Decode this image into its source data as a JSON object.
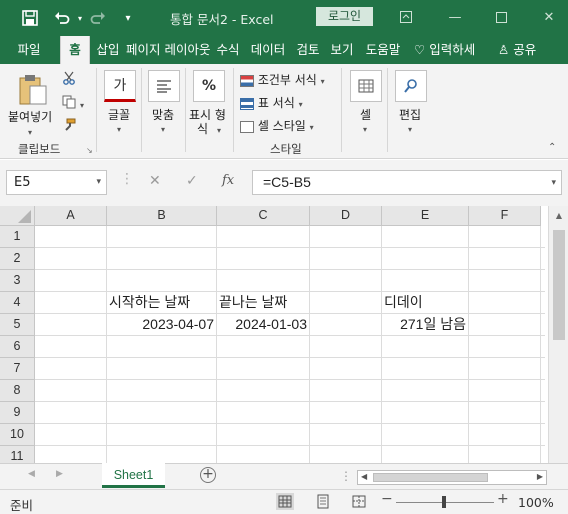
{
  "window": {
    "title": "통합 문서2  -  Excel",
    "login_label": "로그인"
  },
  "ribbon_tabs": [
    {
      "label": "파일",
      "active": false
    },
    {
      "label": "홈",
      "active": true
    },
    {
      "label": "삽입",
      "active": false
    },
    {
      "label": "페이지 레이아웃",
      "active": false
    },
    {
      "label": "수식",
      "active": false
    },
    {
      "label": "데이터",
      "active": false
    },
    {
      "label": "검토",
      "active": false
    },
    {
      "label": "보기",
      "active": false
    },
    {
      "label": "도움말",
      "active": false
    }
  ],
  "ribbon_extra": {
    "tell_me": "입력하세",
    "share": "공유"
  },
  "ribbon": {
    "paste": "붙여넣기",
    "clipboard_group": "클립보드",
    "font": "글꼴",
    "font_icon": "가",
    "alignment": "맞춤",
    "number_line1": "표시 형",
    "number_line2": "식",
    "number_icon": "%",
    "conditional_format": "조건부 서식",
    "format_table": "표 서식",
    "cell_style": "셀 스타일",
    "styles_group": "스타일",
    "cells": "셀",
    "editing": "편집"
  },
  "formula_bar": {
    "name_box": "E5",
    "fx": "fx",
    "formula": "=C5-B5"
  },
  "columns": [
    "A",
    "B",
    "C",
    "D",
    "E",
    "F"
  ],
  "rows": [
    "1",
    "2",
    "3",
    "4",
    "5",
    "6",
    "7",
    "8",
    "9",
    "10",
    "11"
  ],
  "cells": {
    "B4": "시작하는 날짜",
    "C4": "끝나는 날짜",
    "E4": "디데이",
    "B5": "2023-04-07",
    "C5": "2024-01-03",
    "E5": "271일 남음"
  },
  "sheets": [
    "Sheet1"
  ],
  "status": {
    "ready": "준비",
    "zoom": "100%"
  },
  "colors": {
    "excel_green": "#217346"
  }
}
